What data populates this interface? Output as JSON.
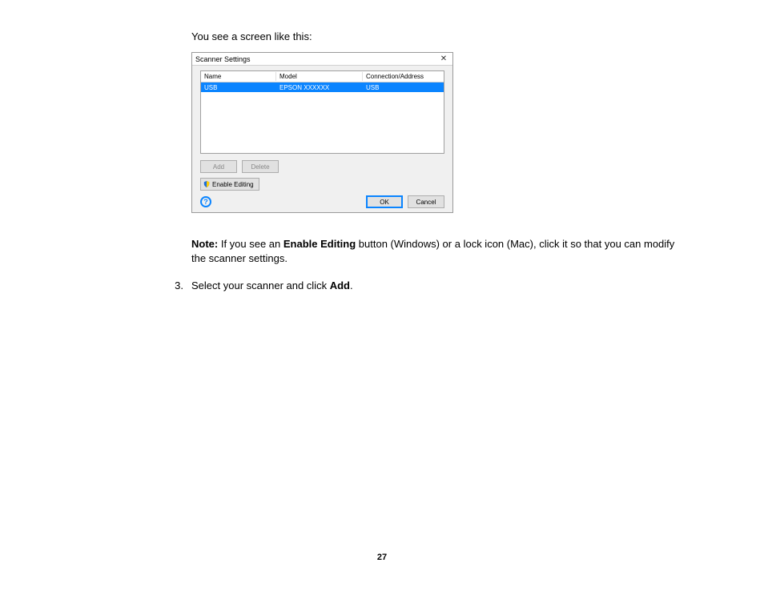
{
  "intro": "You see a screen like this:",
  "dialog": {
    "title": "Scanner Settings",
    "close_glyph": "✕",
    "columns": {
      "name": "Name",
      "model": "Model",
      "connection": "Connection/Address"
    },
    "row": {
      "name": "USB",
      "model": "EPSON XXXXXX",
      "connection": "USB"
    },
    "buttons": {
      "add": "Add",
      "delete": "Delete",
      "enable_editing": "Enable Editing",
      "ok": "OK",
      "cancel": "Cancel"
    },
    "help_glyph": "?"
  },
  "note": {
    "label": "Note:",
    "text_before": " If you see an ",
    "bold1": "Enable Editing",
    "text_mid": " button (Windows) or a lock icon (Mac), click it so that you can modify the scanner settings."
  },
  "step": {
    "num": "3.",
    "text_before": "Select your scanner and click ",
    "bold": "Add",
    "text_after": "."
  },
  "page_number": "27"
}
